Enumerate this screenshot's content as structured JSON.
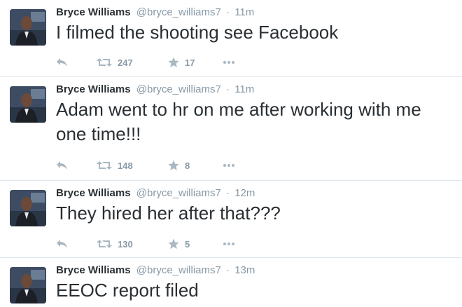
{
  "tweets": [
    {
      "name": "Bryce Williams",
      "handle": "@bryce_williams7",
      "separator": "·",
      "time": "11m",
      "text": "I filmed the shooting see Facebook",
      "retweets": "247",
      "favorites": "17"
    },
    {
      "name": "Bryce Williams",
      "handle": "@bryce_williams7",
      "separator": "·",
      "time": "11m",
      "text": "Adam went to hr on me after working with me one time!!!",
      "retweets": "148",
      "favorites": "8"
    },
    {
      "name": "Bryce Williams",
      "handle": "@bryce_williams7",
      "separator": "·",
      "time": "12m",
      "text": "They hired her after that???",
      "retweets": "130",
      "favorites": "5"
    },
    {
      "name": "Bryce Williams",
      "handle": "@bryce_williams7",
      "separator": "·",
      "time": "13m",
      "text": "EEOC report filed"
    }
  ],
  "icons": {
    "reply": "reply-arrow-icon",
    "retweet": "retweet-icon",
    "favorite": "star-icon",
    "more": "more-dots-icon",
    "avatar": "profile-photo"
  },
  "colors": {
    "text": "#292f33",
    "secondary": "#8899a6",
    "icon": "#aab8c2",
    "divider": "#e1e8ed"
  }
}
